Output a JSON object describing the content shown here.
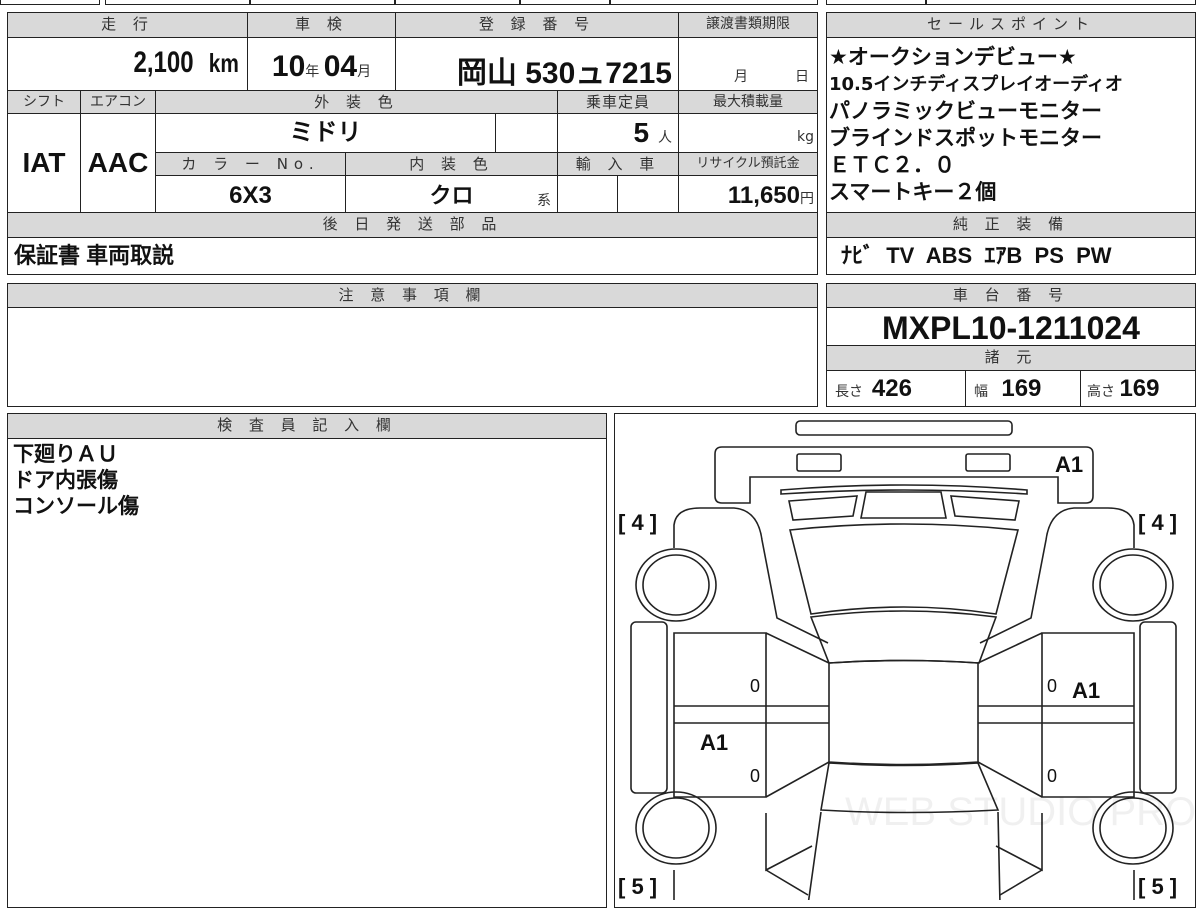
{
  "main_table": {
    "mileage_label": "走 行",
    "mileage_value": "2,100",
    "mileage_unit": "km",
    "inspection_label": "車 検",
    "inspection_year": "10",
    "inspection_year_unit": "年",
    "inspection_month": "04",
    "inspection_month_unit": "月",
    "registration_label": "登 録 番 号",
    "registration_value": "岡山 530ュ7215",
    "transfer_deadline_label": "譲渡書類期限",
    "transfer_month_unit": "月",
    "transfer_day_unit": "日",
    "shift_label": "シフト",
    "shift_value": "IAT",
    "aircon_label": "エアコン",
    "aircon_value": "AAC",
    "exterior_color_label": "外 装 色",
    "exterior_color_value": "ミドリ",
    "capacity_label": "乗車定員",
    "capacity_value": "5",
    "capacity_unit": "人",
    "max_load_label": "最大積載量",
    "max_load_unit": "kg",
    "color_no_label": "カ ラ ー No.",
    "color_no_value": "6X3",
    "interior_color_label": "内 装 色",
    "interior_color_value": "クロ",
    "interior_color_suffix": "系",
    "import_label": "輸 入 車",
    "recycle_label": "リサイクル預託金",
    "recycle_value": "11,650",
    "recycle_unit": "円",
    "later_parts_label": "後 日 発 送 部 品",
    "later_parts_value": "保証書 車両取説"
  },
  "sales_points": {
    "label": "セールスポイント",
    "lines": [
      "★オークションデビュー★",
      "10.5インチディスプレイオーディオ",
      "パノラミックビューモニター",
      "ブラインドスポットモニター",
      "ＥＴＣ２．０",
      "スマートキー２個"
    ]
  },
  "equipment": {
    "label": "純 正 装 備",
    "value": "ﾅﾋﾞ  TV  ABS  ｴｱB  PS  PW"
  },
  "notes": {
    "label": "注 意 事 項 欄",
    "value": ""
  },
  "chassis": {
    "label": "車 台 番 号",
    "value": "MXPL10-1211024"
  },
  "specs": {
    "label": "諸 元",
    "length_label": "長さ",
    "length_value": "426",
    "width_label": "幅",
    "width_value": "169",
    "height_label": "高さ",
    "height_value": "169"
  },
  "inspector": {
    "label": "検 査 員 記 入 欄",
    "lines": [
      "下廻りＡＵ",
      "ドア内張傷",
      "コンソール傷"
    ]
  },
  "diagram": {
    "front_left_tire": "[ 4 ]",
    "front_right_tire": "[ 4 ]",
    "rear_left_tire": "[ 5 ]",
    "rear_right_tire": "[ 5 ]",
    "mark_front": "A1",
    "mark_right_front_door": "A1",
    "mark_left_rear_door": "A1",
    "zero_1": "0",
    "zero_2": "0",
    "zero_3": "0",
    "zero_4": "0",
    "watermark": "WEB STUDIO PRO"
  }
}
